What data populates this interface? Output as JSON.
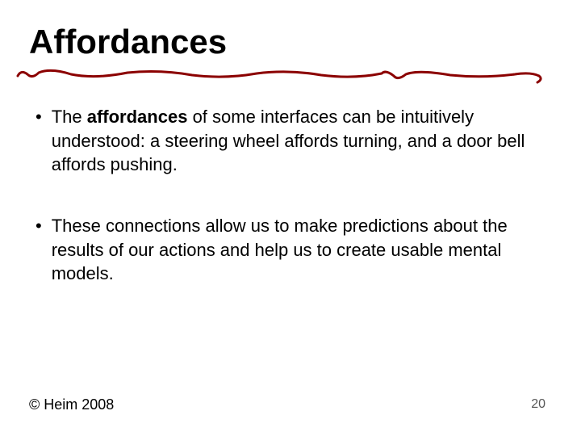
{
  "title": "Affordances",
  "bullets": [
    {
      "prefix": "The ",
      "bold": "affordances",
      "suffix": " of some interfaces can be intuitively understood: a steering wheel affords turning, and a door bell affords pushing."
    },
    {
      "prefix": "",
      "bold": "",
      "suffix": "These connections allow us to make predictions about the results of our actions and help us to create usable mental models."
    }
  ],
  "footer": {
    "copyright": "© Heim 2008",
    "page": "20"
  },
  "colors": {
    "underline": "#8B0000"
  }
}
